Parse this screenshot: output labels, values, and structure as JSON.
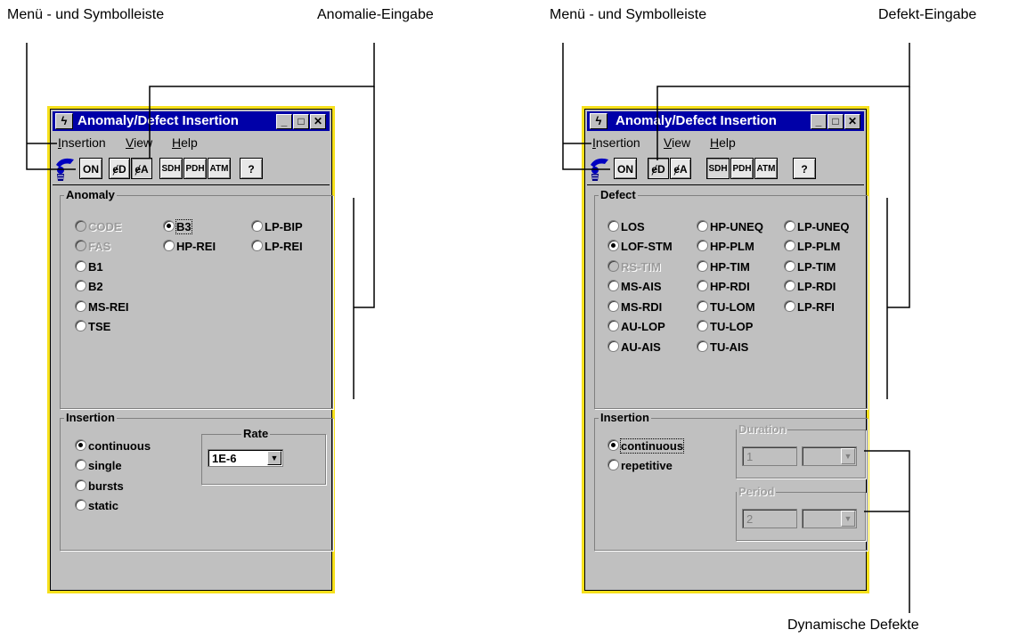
{
  "annotations": {
    "left_menu": "Menü - und Symbolleiste",
    "left_input": "Anomalie-Eingabe",
    "right_menu": "Menü - und Symbolleiste",
    "right_input": "Defekt-Eingabe",
    "dynamic": "Dynamische Defekte"
  },
  "window_left": {
    "title": "Anomaly/Defect Insertion",
    "menu": [
      {
        "label": "Insertion",
        "u": "I",
        "rest": "nsertion"
      },
      {
        "label": "View",
        "u": "V",
        "rest": "iew"
      },
      {
        "label": "Help",
        "u": "H",
        "rest": "elp"
      }
    ],
    "toolbar": {
      "on": "ON",
      "defect": "ɇD",
      "anomaly": "ɇA",
      "sdh": "SDH",
      "pdh": "PDH",
      "atm": "ATM",
      "help": "?"
    },
    "anomaly_group": "Anomaly",
    "anomalies": [
      {
        "label": "CODE",
        "selected": false,
        "disabled": true
      },
      {
        "label": "FAS",
        "selected": false,
        "disabled": true
      },
      {
        "label": "B1",
        "selected": false,
        "disabled": false
      },
      {
        "label": "B2",
        "selected": false,
        "disabled": false
      },
      {
        "label": "MS-REI",
        "selected": false,
        "disabled": false
      },
      {
        "label": "TSE",
        "selected": false,
        "disabled": false
      },
      {
        "label": "B3",
        "selected": true,
        "disabled": false
      },
      {
        "label": "HP-REI",
        "selected": false,
        "disabled": false
      },
      {
        "label": "LP-BIP",
        "selected": false,
        "disabled": false
      },
      {
        "label": "LP-REI",
        "selected": false,
        "disabled": false
      }
    ],
    "insertion_group": "Insertion",
    "insertion_modes": [
      {
        "label": "continuous",
        "selected": true
      },
      {
        "label": "single",
        "selected": false
      },
      {
        "label": "bursts",
        "selected": false
      },
      {
        "label": "static",
        "selected": false
      }
    ],
    "rate_label": "Rate",
    "rate_value": "1E-6"
  },
  "window_right": {
    "title": "Anomaly/Defect Insertion",
    "menu": [
      {
        "label": "Insertion",
        "u": "I",
        "rest": "nsertion"
      },
      {
        "label": "View",
        "u": "V",
        "rest": "iew"
      },
      {
        "label": "Help",
        "u": "H",
        "rest": "elp"
      }
    ],
    "toolbar": {
      "on": "ON",
      "defect": "ɇD",
      "anomaly": "ɇA",
      "sdh": "SDH",
      "pdh": "PDH",
      "atm": "ATM",
      "help": "?"
    },
    "defect_group": "Defect",
    "defects": [
      {
        "label": "LOS",
        "selected": false,
        "disabled": false
      },
      {
        "label": "LOF-STM",
        "selected": true,
        "disabled": false
      },
      {
        "label": "RS-TIM",
        "selected": false,
        "disabled": true
      },
      {
        "label": "MS-AIS",
        "selected": false,
        "disabled": false
      },
      {
        "label": "MS-RDI",
        "selected": false,
        "disabled": false
      },
      {
        "label": "AU-LOP",
        "selected": false,
        "disabled": false
      },
      {
        "label": "AU-AIS",
        "selected": false,
        "disabled": false
      },
      {
        "label": "HP-UNEQ",
        "selected": false,
        "disabled": false
      },
      {
        "label": "HP-PLM",
        "selected": false,
        "disabled": false
      },
      {
        "label": "HP-TIM",
        "selected": false,
        "disabled": false
      },
      {
        "label": "HP-RDI",
        "selected": false,
        "disabled": false
      },
      {
        "label": "TU-LOM",
        "selected": false,
        "disabled": false
      },
      {
        "label": "TU-LOP",
        "selected": false,
        "disabled": false
      },
      {
        "label": "TU-AIS",
        "selected": false,
        "disabled": false
      },
      {
        "label": "LP-UNEQ",
        "selected": false,
        "disabled": false
      },
      {
        "label": "LP-PLM",
        "selected": false,
        "disabled": false
      },
      {
        "label": "LP-TIM",
        "selected": false,
        "disabled": false
      },
      {
        "label": "LP-RDI",
        "selected": false,
        "disabled": false
      },
      {
        "label": "LP-RFI",
        "selected": false,
        "disabled": false
      }
    ],
    "insertion_group": "Insertion",
    "insertion_modes": [
      {
        "label": "continuous",
        "selected": true
      },
      {
        "label": "repetitive",
        "selected": false
      }
    ],
    "duration_label": "Duration",
    "duration_value": "1",
    "period_label": "Period",
    "period_value": "2"
  },
  "colors": {
    "titlebar": "#0000a8",
    "window_border": "#f6e01c",
    "face": "#c0c0c0"
  }
}
